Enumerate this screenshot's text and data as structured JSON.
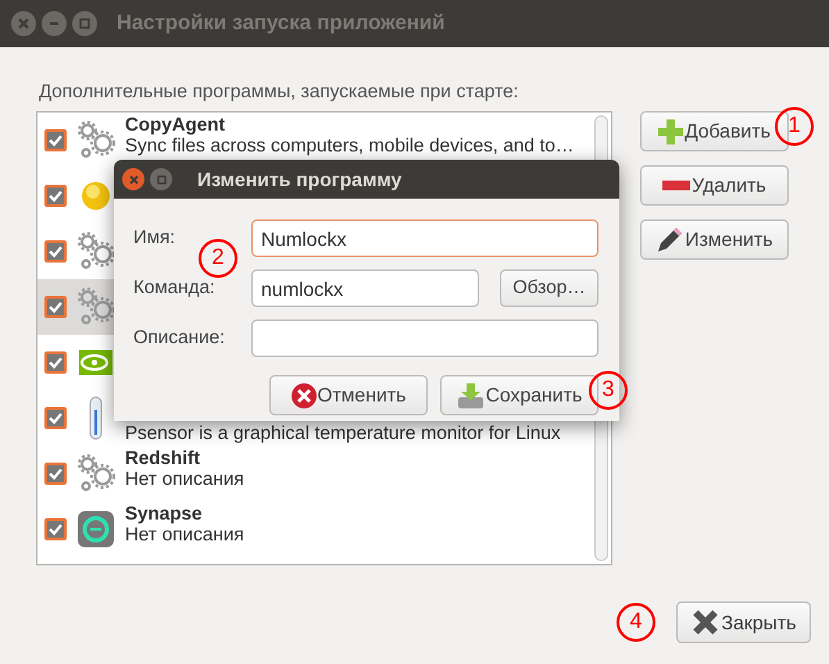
{
  "window": {
    "title": "Настройки запуска приложений"
  },
  "list_label": "Дополнительные программы, запускаемые при старте:",
  "startup_items": [
    {
      "name": "CopyAgent",
      "description": "Sync files across computers, mobile devices, and to…",
      "checked": true,
      "selected": false
    },
    {
      "checked": true,
      "selected": false
    },
    {
      "checked": true,
      "selected": false
    },
    {
      "checked": true,
      "selected": true
    },
    {
      "checked": true,
      "selected": false
    },
    {
      "description": "Psensor is a graphical temperature monitor for Linux",
      "checked": true,
      "selected": false
    },
    {
      "name": "Redshift",
      "description": "Нет описания",
      "checked": true,
      "selected": false
    },
    {
      "name": "Synapse",
      "description": "Нет описания",
      "checked": true,
      "selected": false
    }
  ],
  "side_buttons": [
    {
      "label": "Добавить",
      "kind": "add"
    },
    {
      "label": "Удалить",
      "kind": "remove"
    },
    {
      "label": "Изменить",
      "kind": "edit"
    }
  ],
  "close_button": {
    "label": "Закрыть"
  },
  "dialog": {
    "title": "Изменить программу",
    "fields": [
      {
        "label": "Имя:",
        "value": "Numlockx",
        "focused": true
      },
      {
        "label": "Команда:",
        "value": "numlockx",
        "focused": false,
        "browse": "Обзор…"
      },
      {
        "label": "Описание:",
        "focused": false
      }
    ],
    "buttons": [
      {
        "label": "Отменить",
        "kind": "cancel"
      },
      {
        "label": "Сохранить",
        "kind": "save"
      }
    ]
  },
  "annotations": [
    "1",
    "2",
    "3",
    "4"
  ]
}
